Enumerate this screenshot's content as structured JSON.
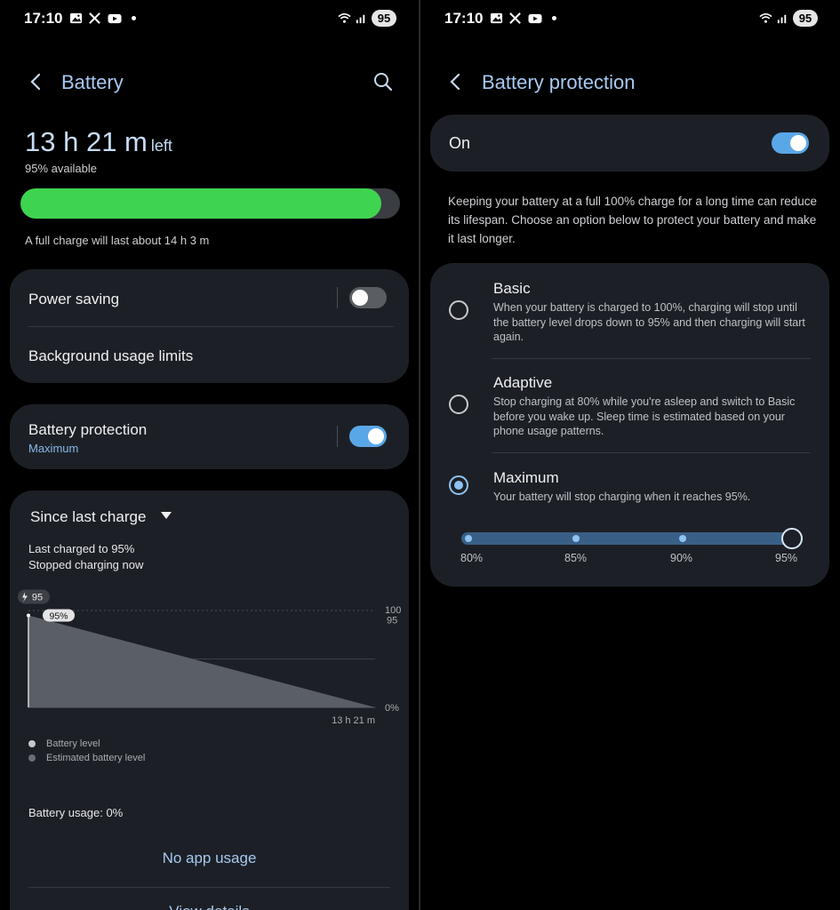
{
  "left": {
    "status": {
      "time": "17:10",
      "battery_level": "95"
    },
    "header": {
      "title": "Battery"
    },
    "summary": {
      "time_value": "13 h 21 m",
      "time_suffix": "left",
      "available": "95% available",
      "level_fraction": 0.95,
      "full_charge": "A full charge will last about 14 h 3 m"
    },
    "power_card": {
      "power_saving": "Power saving",
      "power_saving_on": false,
      "background_limits": "Background usage limits"
    },
    "protection_card": {
      "label": "Battery protection",
      "sub": "Maximum",
      "on": true
    },
    "usage_card": {
      "since_label": "Since last charge",
      "last_charged": "Last charged to 95%",
      "stopped": "Stopped charging now",
      "battery_usage": "Battery usage: 0%",
      "no_app_usage": "No app usage",
      "view_details": "View details"
    },
    "chart_data": {
      "type": "area",
      "x": [
        "0",
        "13 h 21 m"
      ],
      "series": [
        {
          "name": "Estimated battery level",
          "values": [
            95,
            0
          ]
        }
      ],
      "charge_badge": "95",
      "point_label": "95%",
      "y_tick_labels": [
        "100",
        "95",
        "0%"
      ],
      "x_end_label": "13 h 21 m",
      "ylim": [
        0,
        100
      ],
      "legend": [
        "Battery level",
        "Estimated battery level"
      ],
      "legend_colors": [
        "#c8c8cc",
        "#6b6f75"
      ],
      "fill_color": "#5a5f66"
    }
  },
  "right": {
    "status": {
      "time": "17:10",
      "battery_level": "95"
    },
    "header": {
      "title": "Battery protection"
    },
    "master": {
      "label": "On",
      "on": true
    },
    "description": "Keeping your battery at a full 100% charge for a long time can reduce its lifespan. Choose an option below to protect your battery and make it last longer.",
    "options": [
      {
        "title": "Basic",
        "desc": "When your battery is charged to 100%, charging will stop until the battery level drops down to 95% and then charging will start again.",
        "selected": false
      },
      {
        "title": "Adaptive",
        "desc": "Stop charging at 80% while you're asleep and switch to Basic before you wake up. Sleep time is estimated based on your phone usage patterns.",
        "selected": false
      },
      {
        "title": "Maximum",
        "desc": "Your battery will stop charging when it reaches 95%.",
        "selected": true
      }
    ],
    "slider": {
      "ticks": [
        "80%",
        "85%",
        "90%",
        "95%"
      ],
      "selected": "95%"
    }
  },
  "colors": {
    "accent": "#a8c8f0",
    "toggle_on": "#5aa7e8",
    "battery_green": "#3fd44f",
    "card_bg": "#1c2026"
  }
}
